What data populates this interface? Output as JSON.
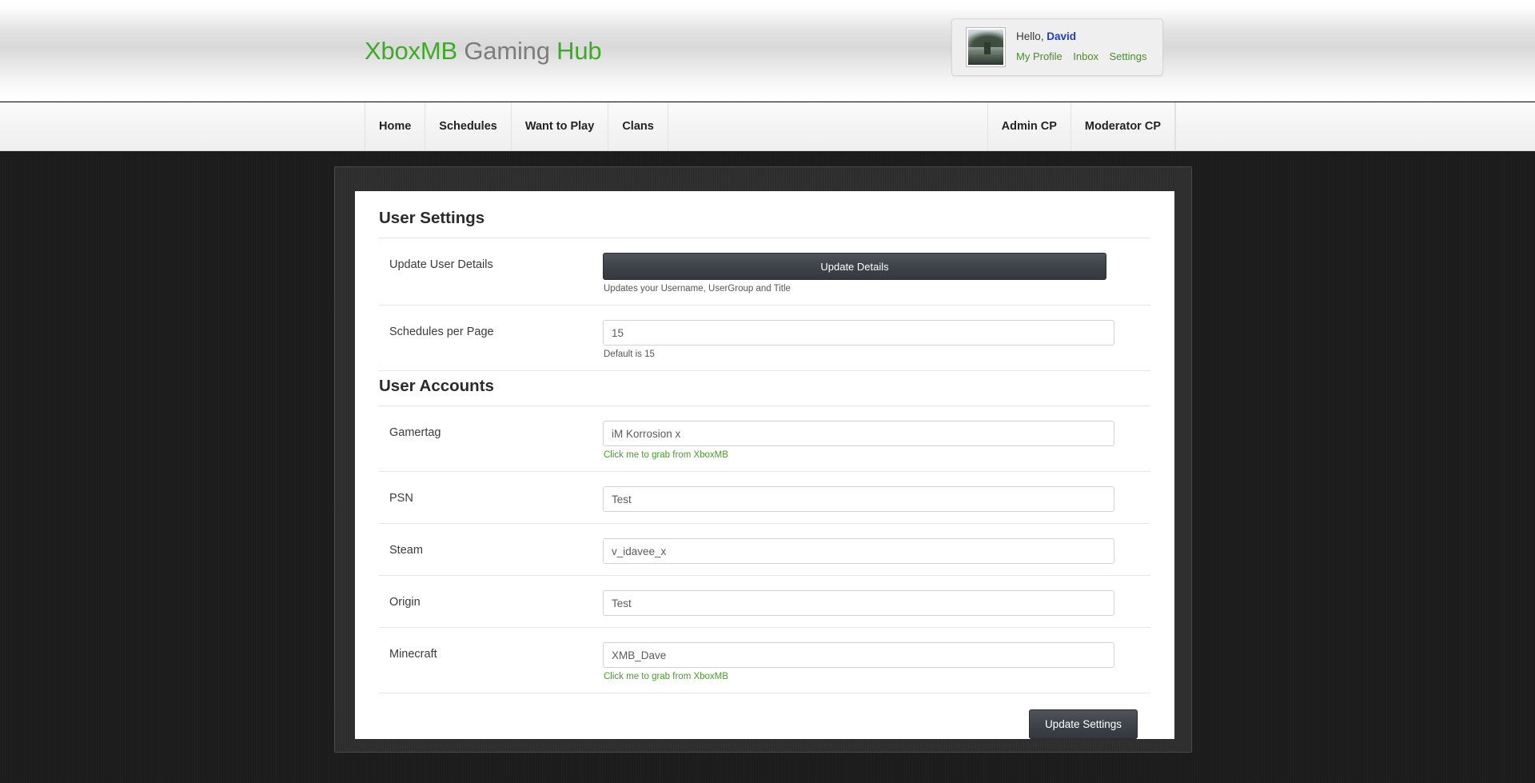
{
  "header": {
    "logo": {
      "part1": "XboxMB",
      "part2": "Gaming",
      "part3": "Hub",
      "green_color": "#3faa29",
      "gray_color": "#7d7d7d"
    },
    "user_card": {
      "greeting": "Hello,",
      "username": "David",
      "avatar_alt": "forest-tree-avatar",
      "links": [
        {
          "label": "My Profile"
        },
        {
          "label": "Inbox"
        },
        {
          "label": "Settings"
        }
      ],
      "link_color": "#4b8b2f",
      "username_color": "#1c3fc0"
    }
  },
  "nav": {
    "left_items": [
      {
        "label": "Home"
      },
      {
        "label": "Schedules"
      },
      {
        "label": "Want to Play"
      },
      {
        "label": "Clans"
      }
    ],
    "right_items": [
      {
        "label": "Admin CP"
      },
      {
        "label": "Moderator CP"
      }
    ]
  },
  "main": {
    "sections": [
      {
        "title": "User Settings",
        "rows": [
          {
            "label": "Update User Details",
            "control": "button",
            "button_label": "Update Details",
            "helper": "Updates your Username, UserGroup and Title",
            "helper_is_link": false
          },
          {
            "label": "Schedules per Page",
            "control": "input",
            "value": "15",
            "helper": "Default is 15",
            "helper_is_link": false
          }
        ]
      },
      {
        "title": "User Accounts",
        "rows": [
          {
            "label": "Gamertag",
            "control": "input",
            "value": "iM Korrosion x",
            "helper": "Click me to grab from XboxMB",
            "helper_is_link": true
          },
          {
            "label": "PSN",
            "control": "input",
            "value": "Test",
            "helper": "",
            "helper_is_link": false
          },
          {
            "label": "Steam",
            "control": "input",
            "value": "v_idavee_x",
            "helper": "",
            "helper_is_link": false
          },
          {
            "label": "Origin",
            "control": "input",
            "value": "Test",
            "helper": "",
            "helper_is_link": false
          },
          {
            "label": "Minecraft",
            "control": "input",
            "value": "XMB_Dave",
            "helper": "Click me to grab from XboxMB",
            "helper_is_link": true
          }
        ]
      }
    ],
    "submit_label": "Update Settings"
  }
}
